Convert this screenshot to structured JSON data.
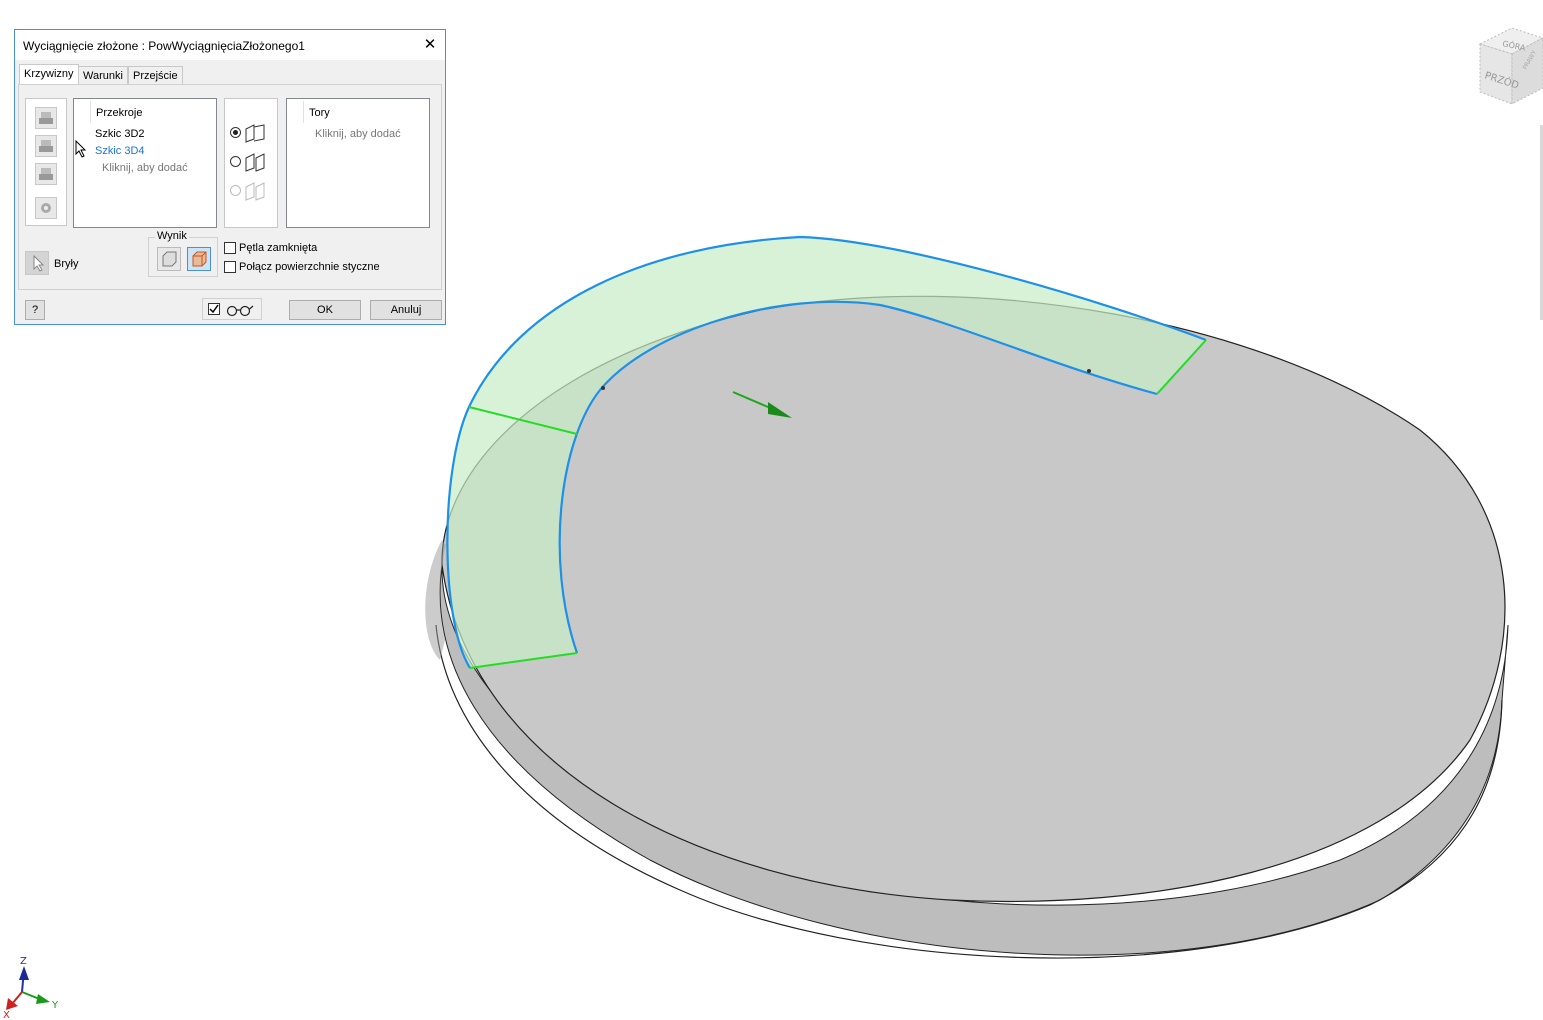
{
  "dialog": {
    "title": "Wyciągnięcie złożone : PowWyciągnięciaZłożonego1",
    "close_symbol": "✕",
    "tabs": [
      {
        "label": "Krzywizny",
        "active": true
      },
      {
        "label": "Warunki",
        "active": false
      },
      {
        "label": "Przejście",
        "active": false
      }
    ],
    "sections": {
      "header": "Przekroje",
      "items": [
        {
          "label": "Szkic 3D2",
          "color": "#000000"
        },
        {
          "label": "Szkic 3D4",
          "color": "#1a73d9"
        }
      ],
      "add_placeholder": "Kliknij, aby dodać"
    },
    "rails": {
      "header": "Tory",
      "add_placeholder": "Kliknij, aby dodać"
    },
    "type_options": [
      {
        "icon": "rails-option-icon",
        "selected": true,
        "enabled": true
      },
      {
        "icon": "center-line-option-icon",
        "selected": false,
        "enabled": true
      },
      {
        "icon": "area-loft-option-icon",
        "selected": false,
        "enabled": false
      }
    ],
    "solids_label": "Bryły",
    "output": {
      "group_label": "Wynik",
      "selected": "surface"
    },
    "options": {
      "closed_loop": {
        "label": "Pętla zamknięta",
        "checked": false
      },
      "merge_tangent": {
        "label": "Połącz powierzchnie styczne",
        "checked": false
      }
    },
    "preview_checked": true,
    "ok_label": "OK",
    "cancel_label": "Anuluj",
    "help_symbol": "?"
  },
  "viewcube": {
    "top_label": "GÓRA",
    "front_label": "PRZÓD",
    "right_label": "PRAWY"
  },
  "triad": {
    "x_label": "X",
    "y_label": "Y",
    "z_label": "Z"
  },
  "colors": {
    "surface_edge": "#1e90e6",
    "section_line": "#22dd22",
    "surface_fill": "#c8ecc8",
    "disc_top": "#c8c8c8",
    "disc_side": "#bdbdbd"
  }
}
